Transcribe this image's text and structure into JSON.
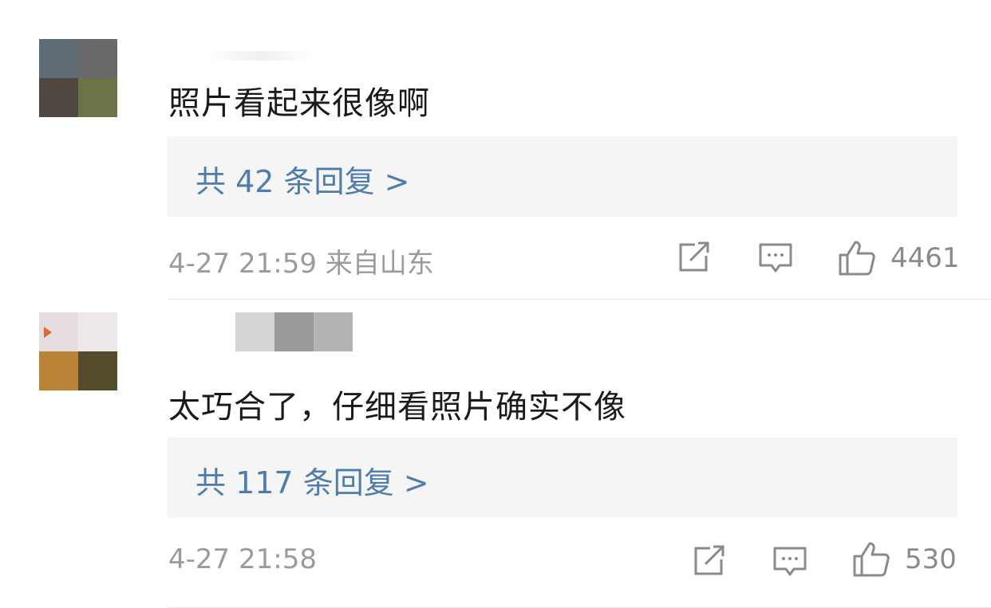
{
  "comments": [
    {
      "text": "照片看起来很像啊",
      "reply_link": "共 42 条回复 >",
      "meta": "4-27 21:59 来自山东",
      "likes": "4461",
      "icons": {
        "share": "share-icon",
        "comment": "comment-icon",
        "like": "thumbs-up-icon"
      }
    },
    {
      "text": "太巧合了，仔细看照片确实不像",
      "reply_link": "共 117 条回复 >",
      "meta": "4-27 21:58",
      "likes": "530",
      "icons": {
        "share": "share-icon",
        "comment": "comment-icon",
        "like": "thumbs-up-icon"
      }
    }
  ],
  "colors": {
    "link": "#4f7dab",
    "reply_bg": "#f5f5f5",
    "meta_text": "#9b9b9b",
    "body_text": "#1a1a1a"
  }
}
